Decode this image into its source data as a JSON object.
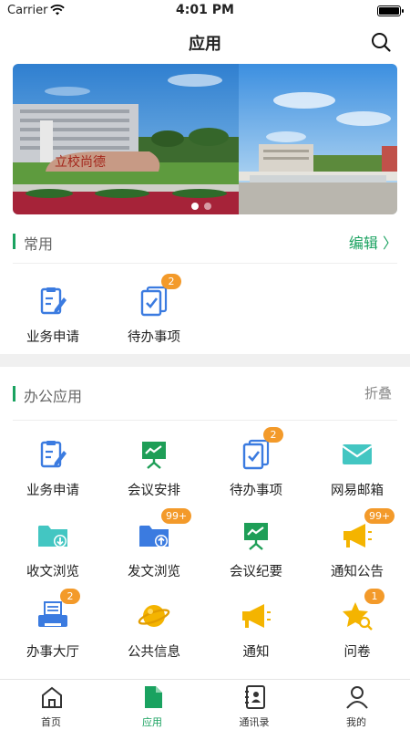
{
  "status": {
    "carrier": "Carrier",
    "time": "4:01 PM"
  },
  "nav": {
    "title": "应用"
  },
  "banner": {
    "stone_text": "立校尚德",
    "slides": 2,
    "active_slide": 1
  },
  "common": {
    "title": "常用",
    "action": "编辑 〉",
    "items": [
      {
        "label": "业务申请",
        "icon": "form-edit-icon"
      },
      {
        "label": "待办事项",
        "icon": "todo-check-icon",
        "badge": "2"
      }
    ]
  },
  "office": {
    "title": "办公应用",
    "action": "折叠",
    "items": [
      {
        "label": "业务申请",
        "icon": "form-edit-icon"
      },
      {
        "label": "会议安排",
        "icon": "presentation-board-icon"
      },
      {
        "label": "待办事项",
        "icon": "todo-check-icon",
        "badge": "2"
      },
      {
        "label": "网易邮箱",
        "icon": "mail-icon"
      },
      {
        "label": "收文浏览",
        "icon": "folder-download-icon"
      },
      {
        "label": "发文浏览",
        "icon": "folder-upload-icon",
        "badge": "99+"
      },
      {
        "label": "会议纪要",
        "icon": "presentation-board-icon"
      },
      {
        "label": "通知公告",
        "icon": "megaphone-icon",
        "badge": "99+"
      },
      {
        "label": "办事大厅",
        "icon": "printer-icon",
        "badge": "2"
      },
      {
        "label": "公共信息",
        "icon": "planet-icon"
      },
      {
        "label": "通知",
        "icon": "megaphone-icon"
      },
      {
        "label": "问卷",
        "icon": "star-search-icon",
        "badge": "1"
      }
    ]
  },
  "tabbar": {
    "items": [
      {
        "label": "首页",
        "icon": "home-icon"
      },
      {
        "label": "应用",
        "icon": "document-icon",
        "active": true
      },
      {
        "label": "通讯录",
        "icon": "contacts-book-icon"
      },
      {
        "label": "我的",
        "icon": "user-icon"
      }
    ]
  },
  "colors": {
    "accent": "#1aa260",
    "badge": "#f39a2a",
    "blue_icon": "#3b7be0",
    "green_icon": "#1e9e57",
    "teal_icon": "#43c6c2",
    "yellow_icon": "#f4b400"
  }
}
